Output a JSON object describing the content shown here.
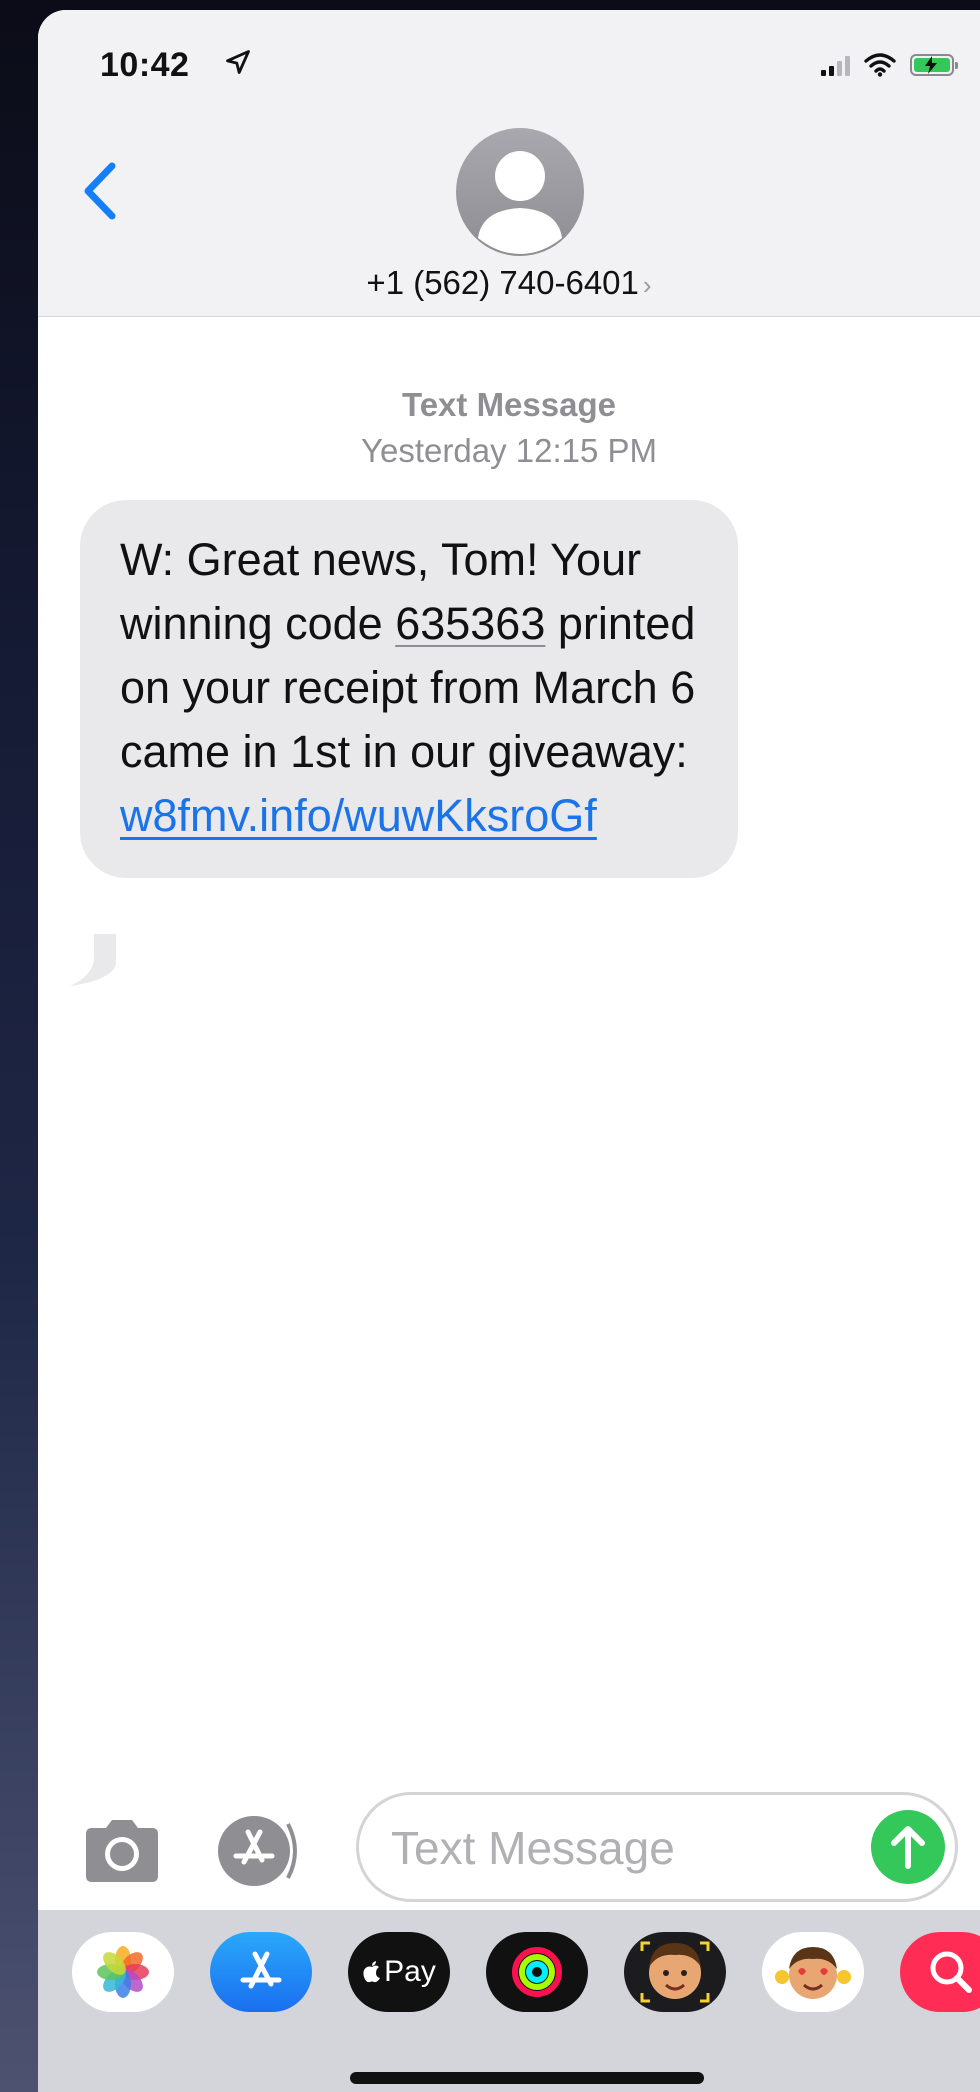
{
  "status_bar": {
    "time": "10:42",
    "location_icon": "location-arrow-icon",
    "signal_icon": "cellular-signal-icon",
    "wifi_icon": "wifi-icon",
    "battery_icon": "battery-charging-icon"
  },
  "nav": {
    "back_icon": "chevron-left-icon",
    "avatar_icon": "person-placeholder-icon",
    "contact": "+1 (562) 740-6401",
    "contact_chevron": "›"
  },
  "conversation": {
    "service": "Text Message",
    "timestamp": "Yesterday 12:15 PM",
    "message": {
      "before_code": "W: Great news, Tom! Your winning code ",
      "code": "635363",
      "after_code": " printed on your receipt from March 6 came in 1st in our giveaway: ",
      "link": "w8fmv.info/wuwKksroGf"
    }
  },
  "compose": {
    "camera_icon": "camera-icon",
    "apps_icon": "app-store-icon",
    "placeholder": "Text Message",
    "value": "",
    "send_icon": "arrow-up-icon"
  },
  "app_drawer": {
    "apps": [
      {
        "name": "Photos",
        "icon": "photos-icon"
      },
      {
        "name": "App Store",
        "icon": "app-store-icon"
      },
      {
        "name": "Apple Pay",
        "icon": "apple-pay-icon",
        "label": "Pay"
      },
      {
        "name": "Activity",
        "icon": "activity-rings-icon"
      },
      {
        "name": "Memoji",
        "icon": "memoji-icon"
      },
      {
        "name": "Memoji Stickers",
        "icon": "memoji-stickers-icon"
      },
      {
        "name": "Search",
        "icon": "images-search-icon"
      }
    ]
  },
  "colors": {
    "accent_blue": "#1a73e8",
    "ios_blue": "#147efb",
    "send_green": "#34c759",
    "bubble_gray": "#e9e9eb",
    "meta_gray": "#8e8e93"
  }
}
